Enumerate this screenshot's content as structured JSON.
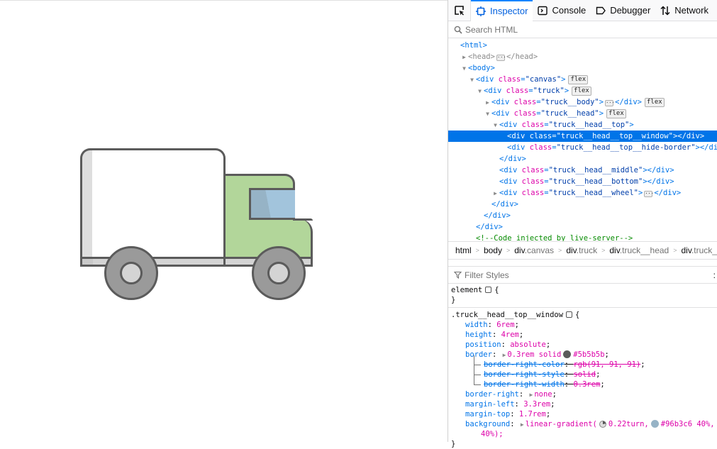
{
  "truck": {
    "colors": {
      "outline": "#5b5b5b",
      "body": "#ffffff",
      "body_shade": "#dedede",
      "cab": "#b2d69a",
      "window_dark": "#96b3c6",
      "window_light": "#a2c4dc",
      "chassis": "#d4d4d4",
      "tire": "#9a9a9a"
    }
  },
  "devtools": {
    "tabs": [
      {
        "label": "Inspector",
        "icon": "inspector-icon",
        "active": true
      },
      {
        "label": "Console",
        "icon": "console-icon",
        "active": false
      },
      {
        "label": "Debugger",
        "icon": "debugger-icon",
        "active": false
      },
      {
        "label": "Network",
        "icon": "network-icon",
        "active": false
      }
    ],
    "search_placeholder": "Search HTML",
    "tree": {
      "html_open": "<html>",
      "head_open": "<head>",
      "head_close": "</head>",
      "body_open": "<body>",
      "canvas": {
        "tag": "<div",
        "attr": "class",
        "val": "\"canvas\"",
        "end": ">",
        "badge": "flex"
      },
      "truck": {
        "tag": "<div",
        "attr": "class",
        "val": "\"truck\"",
        "end": ">",
        "badge": "flex"
      },
      "truck_body": {
        "tag": "<div",
        "attr": "class",
        "val": "\"truck__body\"",
        "end": ">",
        "close": "</div>",
        "badge": "flex"
      },
      "truck_head": {
        "tag": "<div",
        "attr": "class",
        "val": "\"truck__head\"",
        "end": ">",
        "badge": "flex"
      },
      "head_top": {
        "tag": "<div",
        "attr": "class",
        "val": "\"truck__head__top\"",
        "end": ">"
      },
      "head_top_window": {
        "tag": "<div",
        "attr": "class",
        "val": "\"truck__head__top__window\"",
        "end": "></div>"
      },
      "head_top_hide": {
        "tag": "<div",
        "attr": "class",
        "val": "\"truck__head__top__hide-border\"",
        "end": "></div>"
      },
      "close_div": "</div>",
      "head_middle": {
        "tag": "<div",
        "attr": "class",
        "val": "\"truck__head__middle\"",
        "end": "></div>"
      },
      "head_bottom": {
        "tag": "<div",
        "attr": "class",
        "val": "\"truck__head__bottom\"",
        "end": "></div>"
      },
      "head_wheel": {
        "tag": "<div",
        "attr": "class",
        "val": "\"truck__head__wheel\"",
        "end": ">",
        "close": "</div>"
      },
      "comment": "<!--Code injected by live-server-->"
    },
    "breadcrumb": [
      {
        "tag": "html",
        "cls": ""
      },
      {
        "tag": "body",
        "cls": ""
      },
      {
        "tag": "div",
        "cls": ".canvas"
      },
      {
        "tag": "div",
        "cls": ".truck"
      },
      {
        "tag": "div",
        "cls": ".truck__head"
      },
      {
        "tag": "div",
        "cls": ".truck_"
      }
    ],
    "filter_placeholder": "Filter Styles",
    "pseudo_toggle": ":",
    "rules": {
      "element_selector": "element",
      "open_brace": "{",
      "close_brace": "}",
      "selector": ".truck__head__top__window",
      "props": [
        {
          "name": "width",
          "value": "6rem"
        },
        {
          "name": "height",
          "value": "4rem"
        },
        {
          "name": "position",
          "value": "absolute"
        },
        {
          "name": "border",
          "value_pre": "0.3rem solid",
          "color": "#5b5b5b",
          "value_post": "#5b5b5b"
        },
        {
          "name": "border-right-color",
          "value": "rgb(91, 91, 91)",
          "overridden": true
        },
        {
          "name": "border-right-style",
          "value": "solid",
          "overridden": true
        },
        {
          "name": "border-right-width",
          "value": "0.3rem",
          "overridden": true
        },
        {
          "name": "border-right",
          "value": "none"
        },
        {
          "name": "margin-left",
          "value": "3.3rem"
        },
        {
          "name": "margin-top",
          "value": "1.7rem"
        },
        {
          "name": "background",
          "value_pre": "linear-gradient(",
          "angle": "0.22turn,",
          "color": "#96b3c6",
          "value_post": "#96b3c6 40%,",
          "wrap": "40%);"
        }
      ]
    }
  }
}
